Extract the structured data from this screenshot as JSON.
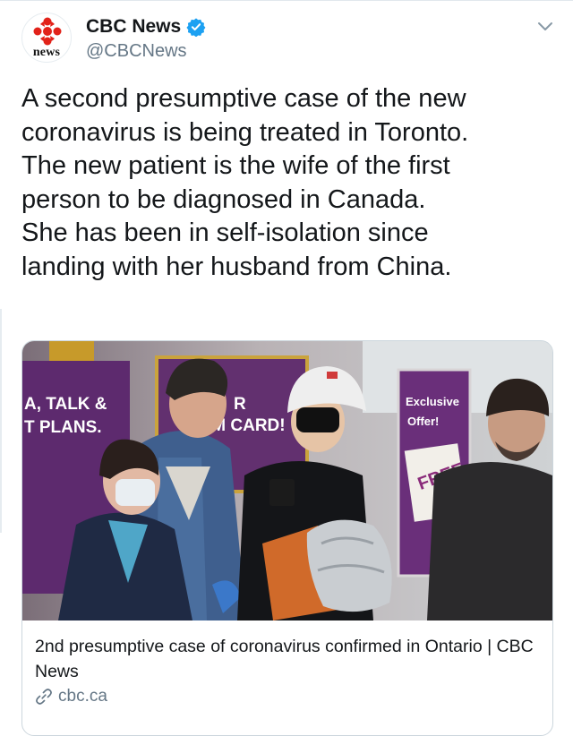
{
  "account": {
    "display_name": "CBC News",
    "handle": "@CBCNews",
    "avatar_word": "news",
    "verified": true
  },
  "tweet": {
    "lines": [
      "A second presumptive case of the new",
      "coronavirus is being treated in Toronto.",
      "The new patient is the wife of the first",
      "person to be diagnosed in Canada.",
      "She has been in self-isolation since",
      "landing with her husband from China."
    ]
  },
  "card": {
    "title": "2nd presumptive case of coronavirus confirmed in Ontario | CBC News",
    "domain": "cbc.ca",
    "photo_signs": {
      "left_line1": "A, TALK &",
      "left_line2": "T PLANS.",
      "center_line1": "R",
      "center_line2": "IM CARD!",
      "right_line1": "Exclusive",
      "right_line2": "Offer!",
      "right_line3": "FREE"
    }
  },
  "colors": {
    "cbc_red": "#e2231a",
    "verified_blue": "#1da1f2",
    "text": "#14171a",
    "muted": "#657786",
    "border": "#ccd6dd"
  },
  "icons": [
    "cbc-gem-icon",
    "verified-badge-icon",
    "chevron-down-icon",
    "link-icon"
  ]
}
